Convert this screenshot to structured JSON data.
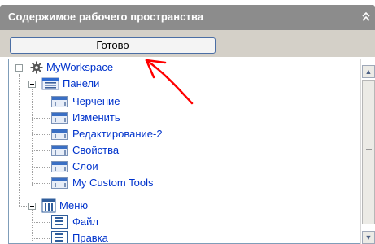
{
  "panel": {
    "title": "Содержимое рабочего пространства",
    "collapse_icon": "double-chevron-up-icon"
  },
  "toolbar": {
    "done_label": "Готово"
  },
  "tree": {
    "root": {
      "label": "MyWorkspace",
      "icon": "gear-icon"
    },
    "panels": {
      "label": "Панели",
      "icon": "toolbar-group-icon",
      "items": [
        {
          "label": "Черчение",
          "icon": "toolbar-icon"
        },
        {
          "label": "Изменить",
          "icon": "toolbar-icon"
        },
        {
          "label": "Редактирование-2",
          "icon": "toolbar-icon"
        },
        {
          "label": "Свойства",
          "icon": "toolbar-icon"
        },
        {
          "label": "Слои",
          "icon": "toolbar-icon"
        },
        {
          "label": "My Custom Tools",
          "icon": "toolbar-icon"
        }
      ]
    },
    "menu": {
      "label": "Меню",
      "icon": "menu-group-icon",
      "items": [
        {
          "label": "Файл",
          "icon": "menu-icon"
        },
        {
          "label": "Правка",
          "icon": "menu-icon"
        }
      ]
    }
  },
  "annotation": {
    "color": "#ff0000"
  },
  "colors": {
    "header_bg": "#8c8c8c",
    "link_text": "#0033cc",
    "button_border": "#4b6ea4"
  }
}
